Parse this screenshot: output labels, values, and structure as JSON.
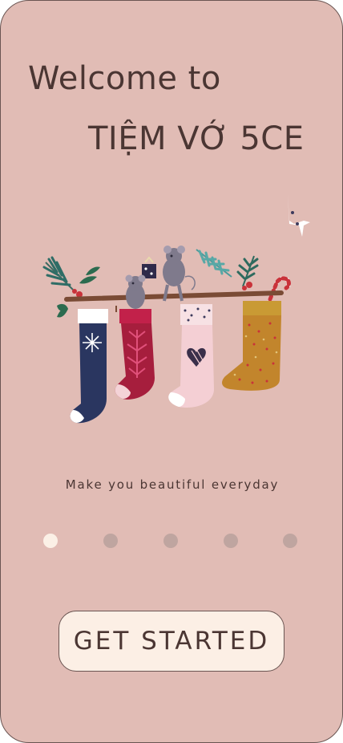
{
  "welcome": {
    "line1": "Welcome to",
    "line2": "TIỆM VỚ 5CE"
  },
  "tagline": "Make you beautiful everyday",
  "pagination": {
    "total": 5,
    "active_index": 0
  },
  "cta": {
    "label": "GET STARTED"
  },
  "colors": {
    "background": "#e1bcb5",
    "text": "#4b3633",
    "button_bg": "#fcefe5",
    "dot_active": "#fbf0e6",
    "dot_inactive": "#bfa5a0"
  },
  "illustration": {
    "icon": "christmas-stockings-illustration"
  }
}
